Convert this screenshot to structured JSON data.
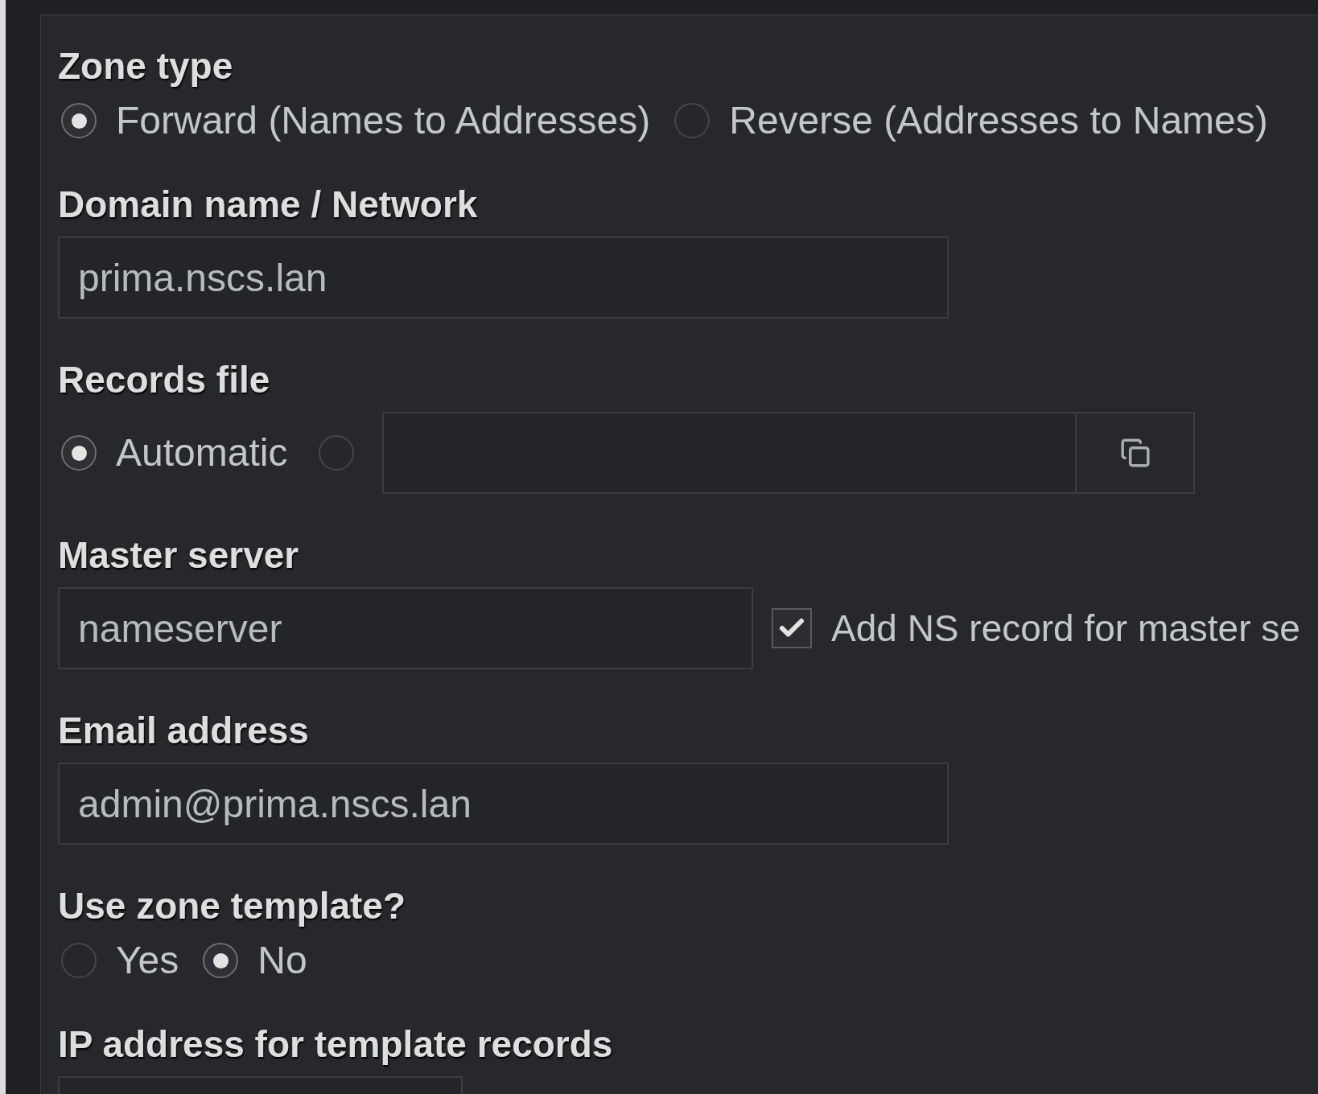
{
  "zone_type": {
    "label": "Zone type",
    "options": [
      {
        "label": "Forward (Names to Addresses)",
        "selected": true
      },
      {
        "label": "Reverse (Addresses to Names)",
        "selected": false
      }
    ]
  },
  "domain_name": {
    "label": "Domain name / Network",
    "value": "prima.nscs.lan"
  },
  "records_file": {
    "label": "Records file",
    "options": [
      {
        "kind": "label",
        "label": "Automatic",
        "selected": true
      },
      {
        "kind": "file",
        "selected": false
      }
    ]
  },
  "master_server": {
    "label": "Master server",
    "value": "nameserver",
    "add_ns_record": {
      "label": "Add NS record for master se",
      "checked": true
    }
  },
  "email_address": {
    "label": "Email address",
    "value": "admin@prima.nscs.lan"
  },
  "use_zone_template": {
    "label": "Use zone template?",
    "options": [
      {
        "label": "Yes",
        "selected": false
      },
      {
        "label": "No",
        "selected": true
      }
    ]
  },
  "template_ip": {
    "label": "IP address for template records"
  }
}
